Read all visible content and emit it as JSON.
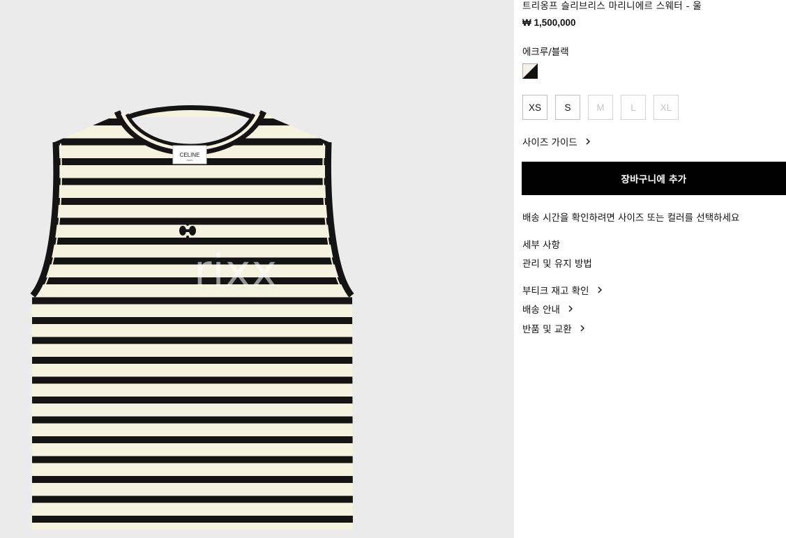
{
  "product": {
    "title": "트리옹프 슬리브리스 마리니에르 스웨터 - 울",
    "price": "₩ 1,500,000",
    "color_name": "에크루/블랙",
    "color_swatch": {
      "name": "ecru-black",
      "colors": [
        "#f4f1e6",
        "#111111"
      ]
    },
    "sizes": [
      {
        "label": "XS",
        "available": true
      },
      {
        "label": "S",
        "available": true
      },
      {
        "label": "M",
        "available": false
      },
      {
        "label": "L",
        "available": false
      },
      {
        "label": "XL",
        "available": false
      }
    ],
    "size_guide_label": "사이즈 가이드",
    "add_to_cart_label": "장바구니에 추가",
    "delivery_notice": "배송 시간을 확인하려면 사이즈 또는 컬러를 선택하세요",
    "details_label": "세부 사항",
    "care_label": "관리 및 유지 방법",
    "boutique_stock_label": "부티크 재고 확인",
    "shipping_label": "배송 안내",
    "returns_label": "반품 및 교환"
  },
  "image": {
    "label_brand": "CELINE",
    "label_sub": "PARIS",
    "watermark": "rixx",
    "garment_colors": {
      "base": "#f5f2df",
      "stripe": "#141414"
    }
  },
  "icons": {
    "chevron": "chevron-right-icon"
  }
}
